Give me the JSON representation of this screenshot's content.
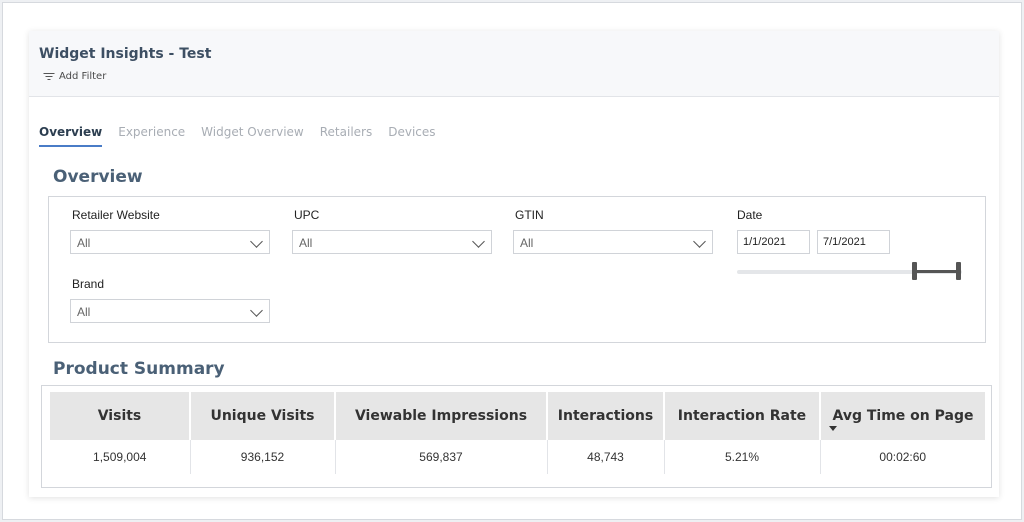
{
  "header": {
    "title": "Widget Insights - Test",
    "add_filter": "Add Filter"
  },
  "tabs": [
    {
      "label": "Overview",
      "active": true
    },
    {
      "label": "Experience",
      "active": false
    },
    {
      "label": "Widget Overview",
      "active": false
    },
    {
      "label": "Retailers",
      "active": false
    },
    {
      "label": "Devices",
      "active": false
    }
  ],
  "overview": {
    "title": "Overview",
    "filters": {
      "retailer": {
        "label": "Retailer Website",
        "value": "All"
      },
      "upc": {
        "label": "UPC",
        "value": "All"
      },
      "gtin": {
        "label": "GTIN",
        "value": "All"
      },
      "brand": {
        "label": "Brand",
        "value": "All"
      },
      "date": {
        "label": "Date",
        "start": "1/1/2021",
        "end": "7/1/2021"
      }
    }
  },
  "summary": {
    "title": "Product Summary",
    "columns": [
      "Visits",
      "Unique Visits",
      "Viewable Impressions",
      "Interactions",
      "Interaction Rate",
      "Avg Time on Page"
    ],
    "rows": [
      [
        "1,509,004",
        "936,152",
        "569,837",
        "48,743",
        "5.21%",
        "00:02:60"
      ]
    ]
  },
  "colors": {
    "title": "#3d4f63",
    "accent": "#4a7cc7",
    "header_bg": "#e6e6e6"
  }
}
